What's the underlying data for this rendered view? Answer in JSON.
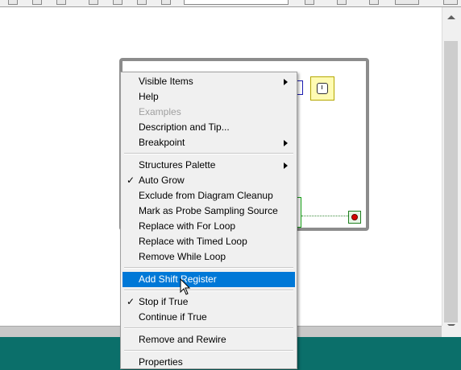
{
  "menu": {
    "items": [
      {
        "label": "Visible Items",
        "submenu": true
      },
      {
        "label": "Help"
      },
      {
        "label": "Examples",
        "disabled": true
      },
      {
        "label": "Description and Tip..."
      },
      {
        "label": "Breakpoint",
        "submenu": true
      },
      {
        "label": "Structures Palette",
        "submenu": true
      },
      {
        "label": "Auto Grow",
        "checked": true
      },
      {
        "label": "Exclude from Diagram Cleanup"
      },
      {
        "label": "Mark as Probe Sampling Source"
      },
      {
        "label": "Replace with For Loop"
      },
      {
        "label": "Replace with Timed Loop"
      },
      {
        "label": "Remove While Loop"
      },
      {
        "label": "Add Shift Register",
        "highlighted": true
      },
      {
        "label": "Stop if True",
        "checked": true
      },
      {
        "label": "Continue if True"
      },
      {
        "label": "Remove and Rewire"
      },
      {
        "label": "Properties"
      }
    ],
    "check_mark": "✓"
  },
  "colors": {
    "highlight": "#0078d7",
    "loop_border": "#8c8c8c",
    "stop_terminal": "#d60000",
    "taskbar": "#0b6f6a"
  },
  "icons": [
    "clock-icon",
    "stop-button-icon",
    "submenu-arrow-icon",
    "check-icon",
    "mouse-cursor-icon"
  ]
}
